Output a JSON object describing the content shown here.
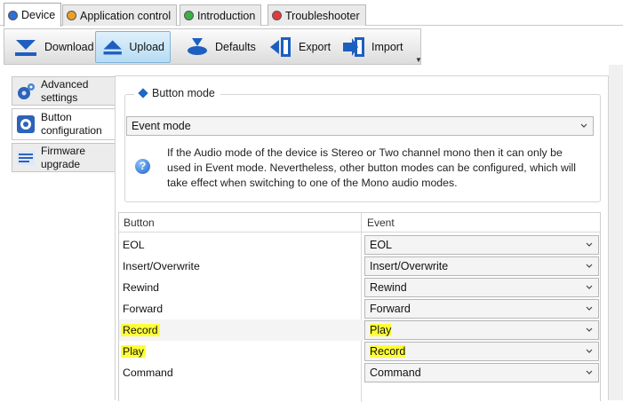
{
  "tabs": [
    {
      "label": "Device",
      "color": "#2f6fd6",
      "active": true
    },
    {
      "label": "Application control",
      "color": "#f0a020",
      "active": false
    },
    {
      "label": "Introduction",
      "color": "#3cb043",
      "active": false
    },
    {
      "label": "Troubleshooter",
      "color": "#e23a3a",
      "active": false
    }
  ],
  "toolbar": {
    "download": "Download",
    "upload": "Upload",
    "defaults": "Defaults",
    "export": "Export",
    "import": "Import",
    "active": "upload"
  },
  "sidebar": {
    "items": [
      {
        "label": "Advanced settings",
        "icon": "gears-icon"
      },
      {
        "label": "Button configuration",
        "icon": "button-config-icon",
        "active": true
      },
      {
        "label": "Firmware upgrade",
        "icon": "firmware-icon"
      }
    ]
  },
  "button_mode": {
    "legend": "Button mode",
    "selected": "Event mode",
    "info": "If the Audio mode of the device is Stereo or Two channel mono then it can only be used in Event mode. Nevertheless, other button modes can be configured, which will take effect when switching to one of the Mono audio modes."
  },
  "table": {
    "headers": [
      "Button",
      "Event"
    ],
    "rows": [
      {
        "button": "EOL",
        "event": "EOL",
        "highlight": false
      },
      {
        "button": "Insert/Overwrite",
        "event": "Insert/Overwrite",
        "highlight": false
      },
      {
        "button": "Rewind",
        "event": "Rewind",
        "highlight": false
      },
      {
        "button": "Forward",
        "event": "Forward",
        "highlight": false
      },
      {
        "button": "Record",
        "event": "Play",
        "highlight": true
      },
      {
        "button": "Play",
        "event": "Record",
        "highlight": true
      },
      {
        "button": "Command",
        "event": "Command",
        "highlight": false
      }
    ]
  },
  "colors": {
    "accent": "#1e66c8",
    "highlight": "#ffff38",
    "active_button_bg": "#b6dcf4"
  }
}
